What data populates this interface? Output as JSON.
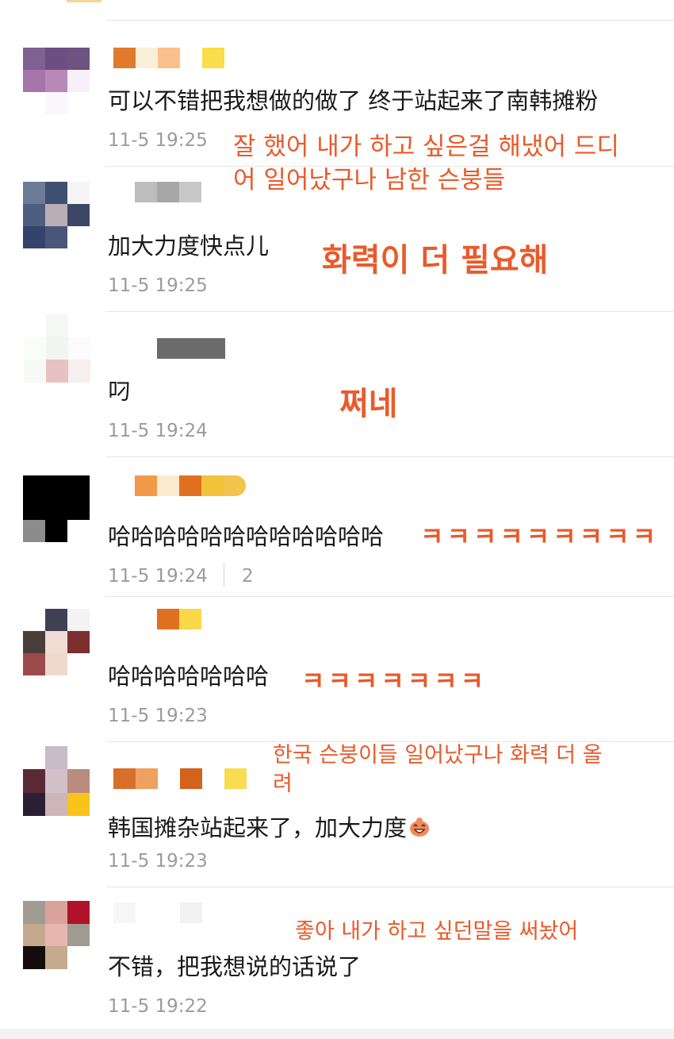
{
  "comments": [
    {
      "text": "可以不错把我想做的做了 终于站起来了南韩摊粉",
      "time": "11-5 19:25",
      "ko": "잘 했어 내가 하고 싶은걸 해냈어 드디\n어 일어났구나 남한 슨붕들"
    },
    {
      "text": "加大力度快点儿",
      "time": "11-5 19:25",
      "ko": "화력이 더 필요해"
    },
    {
      "text": "叼",
      "time": "11-5 19:24",
      "ko": "쩌네"
    },
    {
      "text": "哈哈哈哈哈哈哈哈哈哈哈哈",
      "time": "11-5 19:24",
      "likes": "2",
      "ko": "ㅋㅋㅋㅋㅋㅋㅋㅋㅋ"
    },
    {
      "text": "哈哈哈哈哈哈哈",
      "time": "11-5 19:23",
      "ko": "ㅋㅋㅋㅋㅋㅋㅋ"
    },
    {
      "text": "韩国摊杂站起来了，加大力度",
      "time": "11-5 19:23",
      "ko": "한국 슨붕이들 일어났구나 화력 더 올\n려",
      "emoji": "laughing-face-icon"
    },
    {
      "text": "不错，把我想说的话说了",
      "time": "11-5 19:22",
      "ko": "좋아 내가 하고 싶던말을 써놨어"
    }
  ],
  "colors": {
    "korean_annotation": "#ea5a2a",
    "timestamp": "#9b9b9b",
    "text": "#1a1a1a"
  }
}
